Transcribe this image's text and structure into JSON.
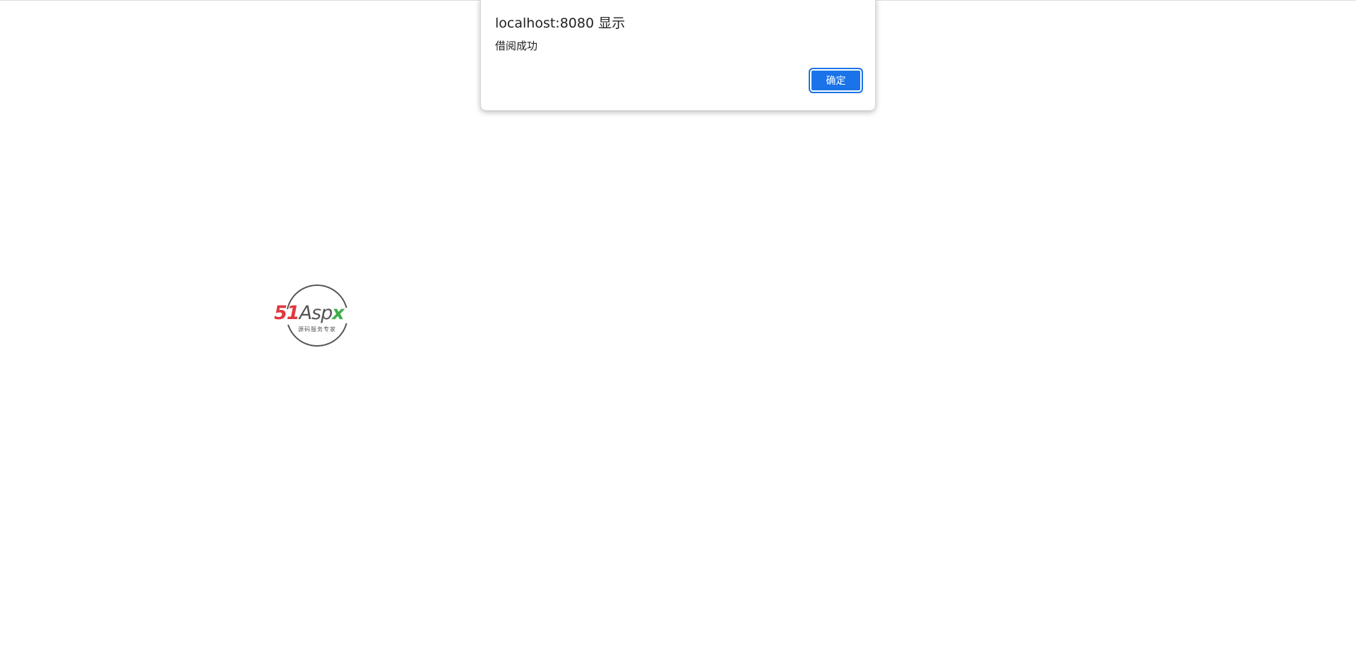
{
  "alert_dialog": {
    "title": "localhost:8080 显示",
    "message": "借阅成功",
    "ok_label": "确定",
    "accent_color": "#1a73e8"
  },
  "logo": {
    "brand_number": "51",
    "brand_mid": "Asp",
    "brand_end": "x",
    "tagline": "源码服务专家",
    "colors": {
      "number": "#e0393e",
      "mid": "#555555",
      "end": "#3fae49"
    }
  }
}
